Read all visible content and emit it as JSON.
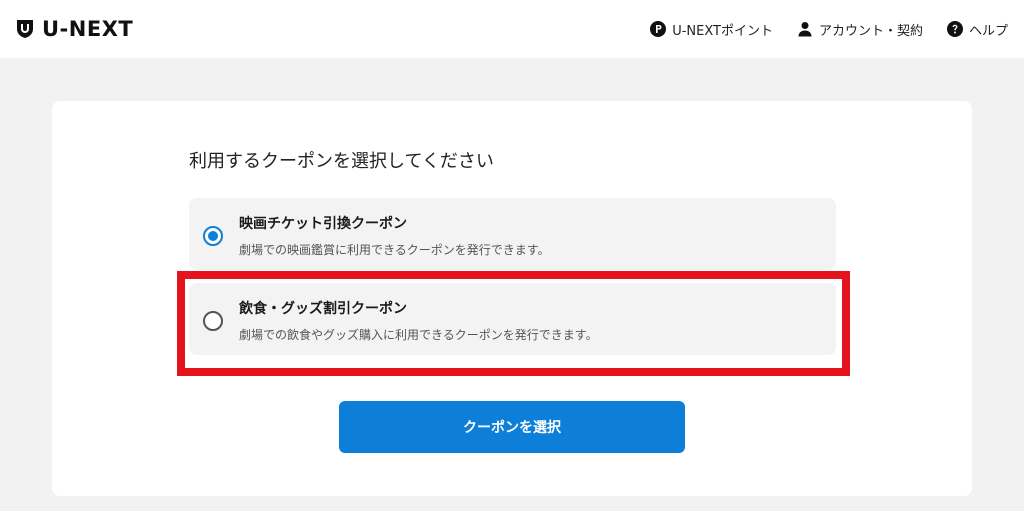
{
  "header": {
    "logo_text": "U-NEXT",
    "nav": [
      {
        "label": "U-NEXTポイント",
        "icon": "points-icon"
      },
      {
        "label": "アカウント・契約",
        "icon": "user-icon"
      },
      {
        "label": "ヘルプ",
        "icon": "help-icon"
      }
    ]
  },
  "main": {
    "title": "利用するクーポンを選択してください",
    "options": [
      {
        "title": "映画チケット引換クーポン",
        "description": "劇場での映画鑑賞に利用できるクーポンを発行できます。",
        "selected": true
      },
      {
        "title": "飲食・グッズ割引クーポン",
        "description": "劇場での飲食やグッズ購入に利用できるクーポンを発行できます。",
        "selected": false
      }
    ],
    "submit_label": "クーポンを選択"
  },
  "colors": {
    "accent": "#0d7fd8",
    "highlight": "#e3141b"
  }
}
